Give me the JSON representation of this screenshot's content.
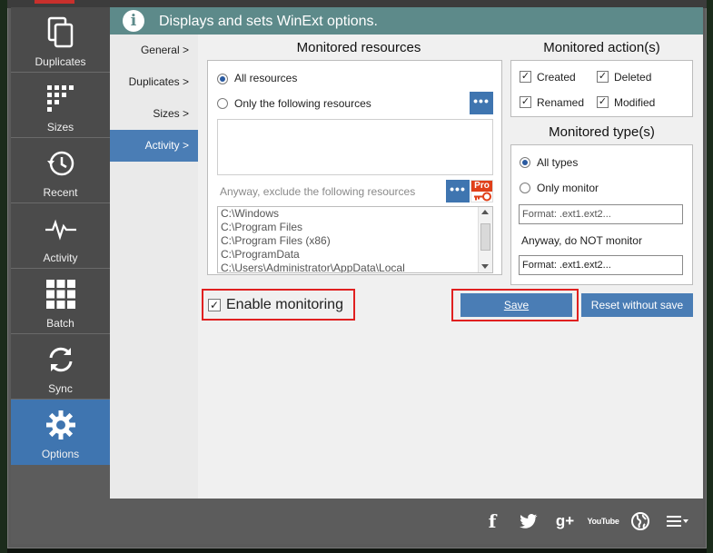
{
  "header": {
    "title": "Displays and sets WinExt options.",
    "info_icon": "i"
  },
  "sidebar": {
    "items": [
      {
        "label": "Duplicates",
        "icon": "duplicates-icon"
      },
      {
        "label": "Sizes",
        "icon": "sizes-icon"
      },
      {
        "label": "Recent",
        "icon": "recent-icon"
      },
      {
        "label": "Activity",
        "icon": "activity-icon"
      },
      {
        "label": "Batch",
        "icon": "batch-icon"
      },
      {
        "label": "Sync",
        "icon": "sync-icon"
      },
      {
        "label": "Options",
        "icon": "options-icon",
        "active": true
      }
    ]
  },
  "subnav": {
    "items": [
      {
        "label": "General  >"
      },
      {
        "label": "Duplicates  >"
      },
      {
        "label": "Sizes  >"
      },
      {
        "label": "Activity  >",
        "active": true
      }
    ]
  },
  "resources": {
    "title": "Monitored resources",
    "all_label": "All resources",
    "only_label": "Only the following resources",
    "selected": "all",
    "browse_label": "•••",
    "exclude_label": "Anyway, exclude the following resources",
    "pro_badge": "Pro",
    "excluded": [
      "C:\\Windows",
      "C:\\Program Files",
      "C:\\Program Files (x86)",
      "C:\\ProgramData",
      "C:\\Users\\Administrator\\AppData\\Local"
    ]
  },
  "actions": {
    "title": "Monitored action(s)",
    "created": "Created",
    "deleted": "Deleted",
    "renamed": "Renamed",
    "modified": "Modified",
    "check_mark": "✓"
  },
  "types": {
    "title": "Monitored type(s)",
    "all_label": "All types",
    "only_label": "Only monitor",
    "selected": "all",
    "only_placeholder": "Format: .ext1.ext2...",
    "not_label": "Anyway, do NOT monitor",
    "not_value": "Format: .ext1.ext2..."
  },
  "enable_monitoring": {
    "label": "Enable monitoring",
    "checked": true,
    "check_mark": "✓"
  },
  "buttons": {
    "save": "Save",
    "reset": "Reset without save"
  },
  "footer": {
    "icons": [
      "facebook-icon",
      "twitter-icon",
      "google-plus-icon",
      "youtube-icon",
      "globe-icon",
      "menu-icon"
    ],
    "facebook": "f",
    "google_plus": "g+",
    "youtube": "YouTube"
  },
  "colors": {
    "accent": "#3f75b0",
    "header": "#5d8a8a",
    "highlight": "#e02020"
  }
}
